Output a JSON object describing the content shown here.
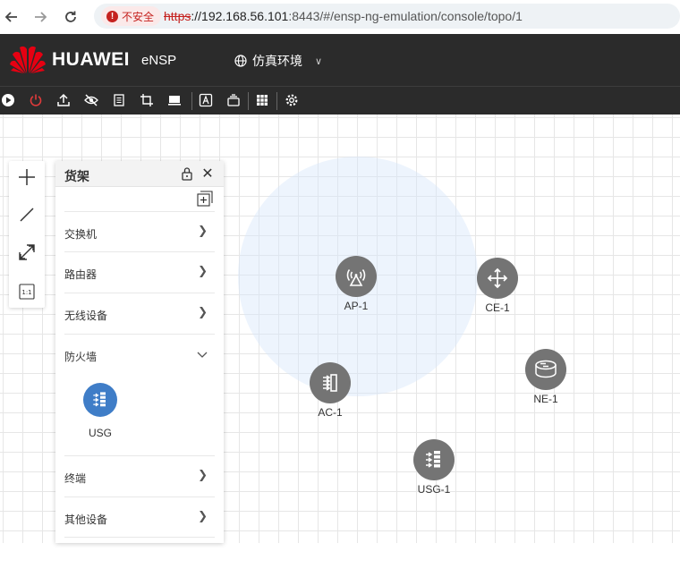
{
  "browser": {
    "security_label": "不安全",
    "url_protocol": "https",
    "url_host": "://192.168.56.101",
    "url_rest": ":8443/#/ensp-ng-emulation/console/topo/1"
  },
  "header": {
    "brand": "HUAWEI",
    "product": "eNSP",
    "environment": "仿真环境",
    "brand_color": "#e60012"
  },
  "toolbar": {
    "buttons": [
      "start-all",
      "stop-all",
      "upload",
      "hide",
      "notes",
      "crop",
      "screen",
      "text-label",
      "layers",
      "grid",
      "settings"
    ]
  },
  "canvas_tools": [
    "add",
    "line",
    "fit-view",
    "actual-size"
  ],
  "actual_size_label": "1:1",
  "shelf": {
    "title": "货架",
    "categories": [
      {
        "label": "交换机",
        "expanded": false
      },
      {
        "label": "路由器",
        "expanded": false
      },
      {
        "label": "无线设备",
        "expanded": false
      },
      {
        "label": "防火墙",
        "expanded": true
      },
      {
        "label": "终端",
        "expanded": false
      },
      {
        "label": "其他设备",
        "expanded": false
      }
    ],
    "firewall_items": [
      {
        "label": "USG"
      }
    ]
  },
  "topology": {
    "nodes": [
      {
        "label": "AP-1",
        "type": "ap"
      },
      {
        "label": "CE-1",
        "type": "switch"
      },
      {
        "label": "AC-1",
        "type": "ac"
      },
      {
        "label": "NE-1",
        "type": "router"
      },
      {
        "label": "USG-1",
        "type": "firewall"
      }
    ]
  }
}
